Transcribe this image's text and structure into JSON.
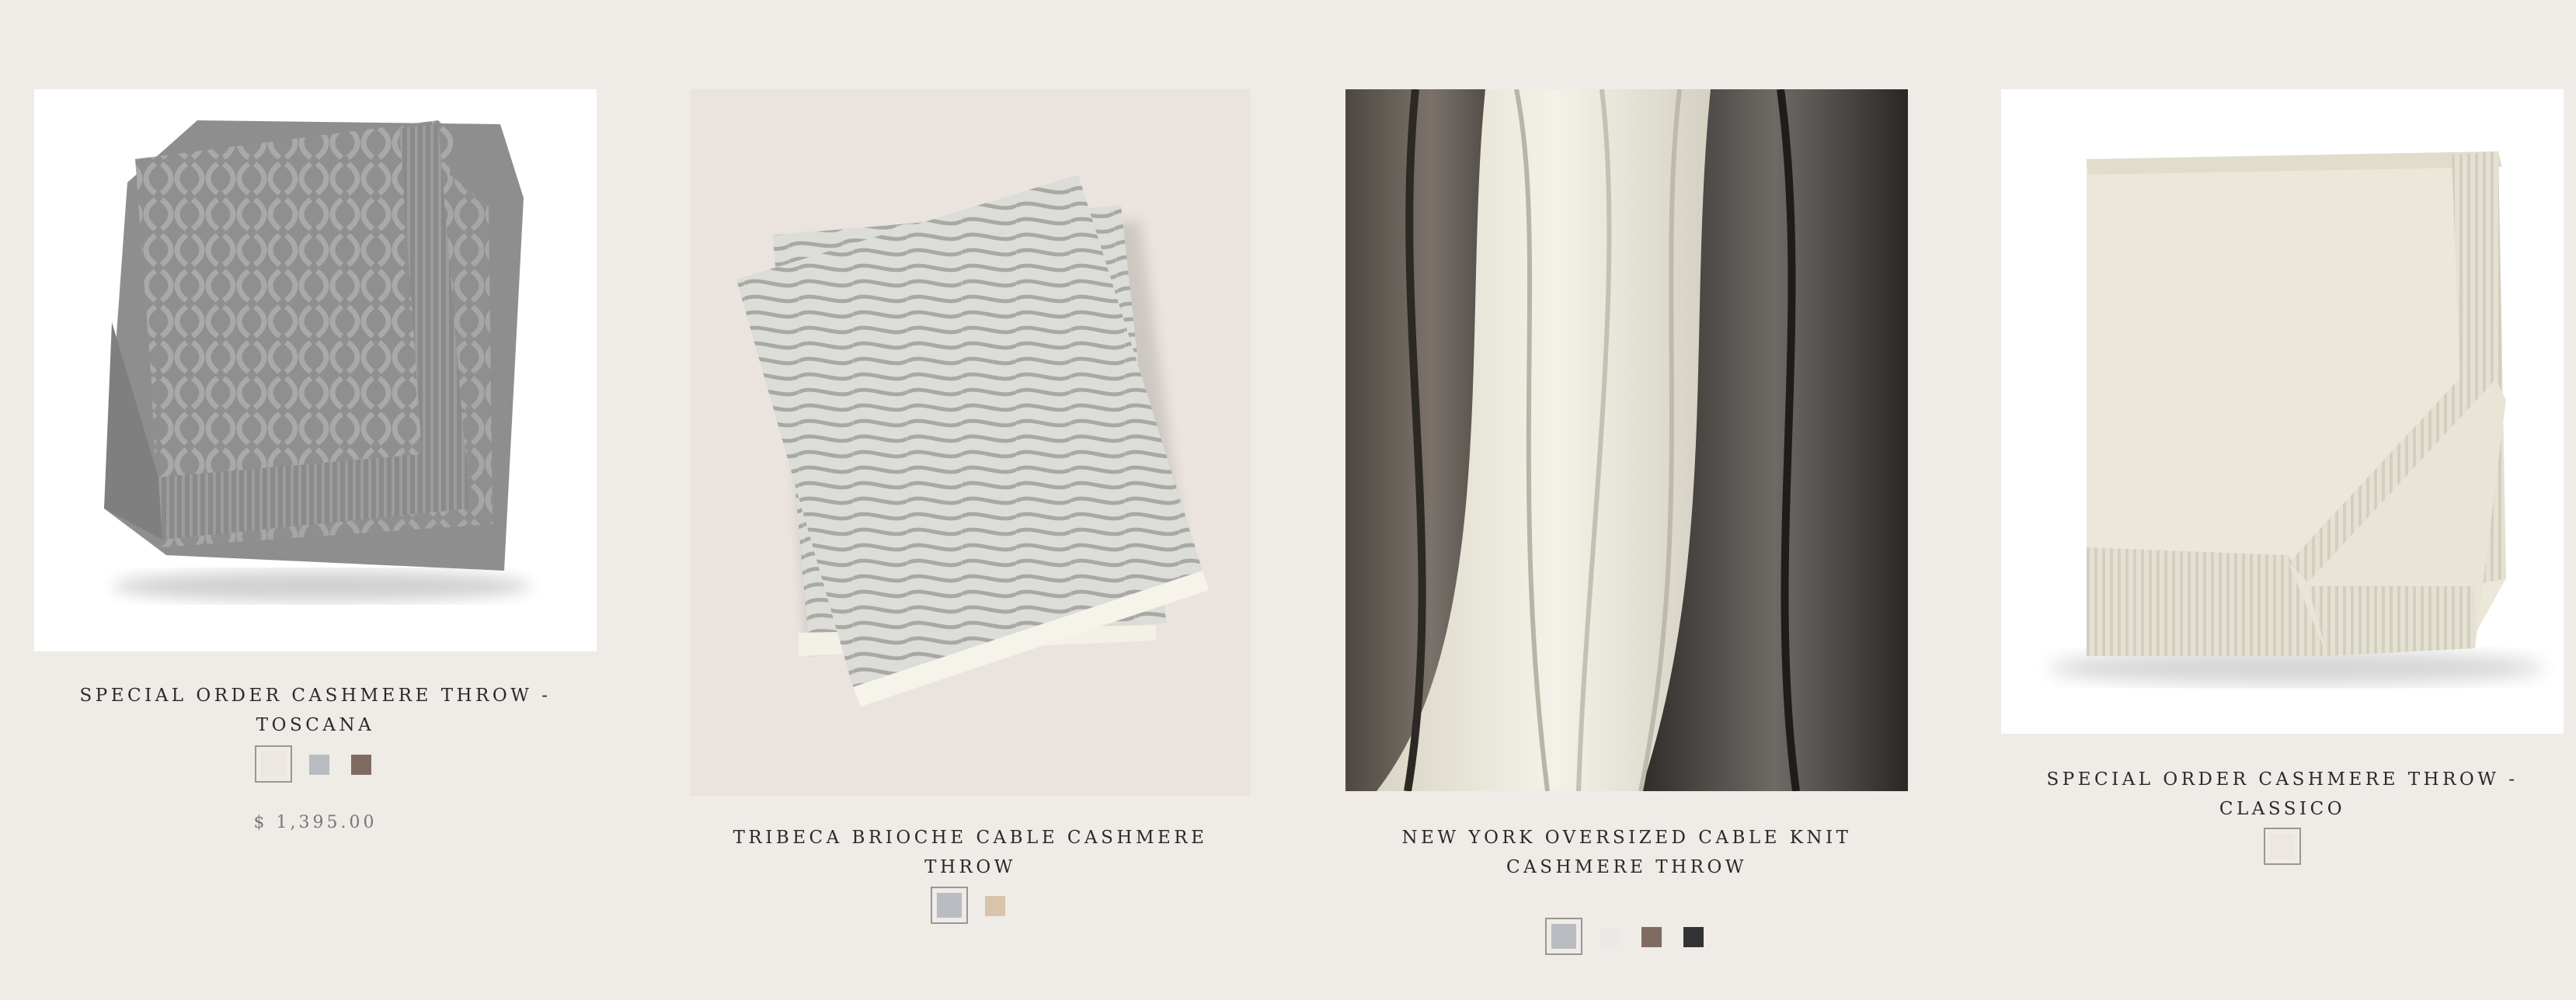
{
  "products": [
    {
      "title": "SPECIAL ORDER CASHMERE THROW - TOSCANA",
      "price": "$ 1,395.00",
      "image": "gray-cable-knit-throw",
      "swatches": [
        {
          "name": "ivory",
          "color": "#ece8e1",
          "selected": true
        },
        {
          "name": "gray",
          "color": "#b9bcc1",
          "selected": false
        },
        {
          "name": "brown",
          "color": "#7f6b60",
          "selected": false
        }
      ]
    },
    {
      "title": "TRIBECA BRIOCHE CABLE CASHMERE THROW",
      "image": "gray-white-brioche-cable-throw",
      "swatches": [
        {
          "name": "gray",
          "color": "#b9bcc1",
          "selected": true
        },
        {
          "name": "camel",
          "color": "#d8c4a8",
          "selected": false
        }
      ]
    },
    {
      "title": "NEW YORK OVERSIZED CABLE KNIT CASHMERE THROW",
      "image": "oversized-cable-knit-throws",
      "swatches": [
        {
          "name": "gray",
          "color": "#b9bcc1",
          "selected": true
        },
        {
          "name": "white",
          "color": "#ebe9e6",
          "selected": false
        },
        {
          "name": "brown",
          "color": "#7f6b60",
          "selected": false
        },
        {
          "name": "charcoal",
          "color": "#333333",
          "selected": false
        }
      ]
    },
    {
      "title": "SPECIAL ORDER CASHMERE THROW - CLASSICO",
      "image": "cream-cashmere-throw",
      "swatches": [
        {
          "name": "ivory",
          "color": "#ece8e1",
          "selected": true
        }
      ]
    }
  ]
}
